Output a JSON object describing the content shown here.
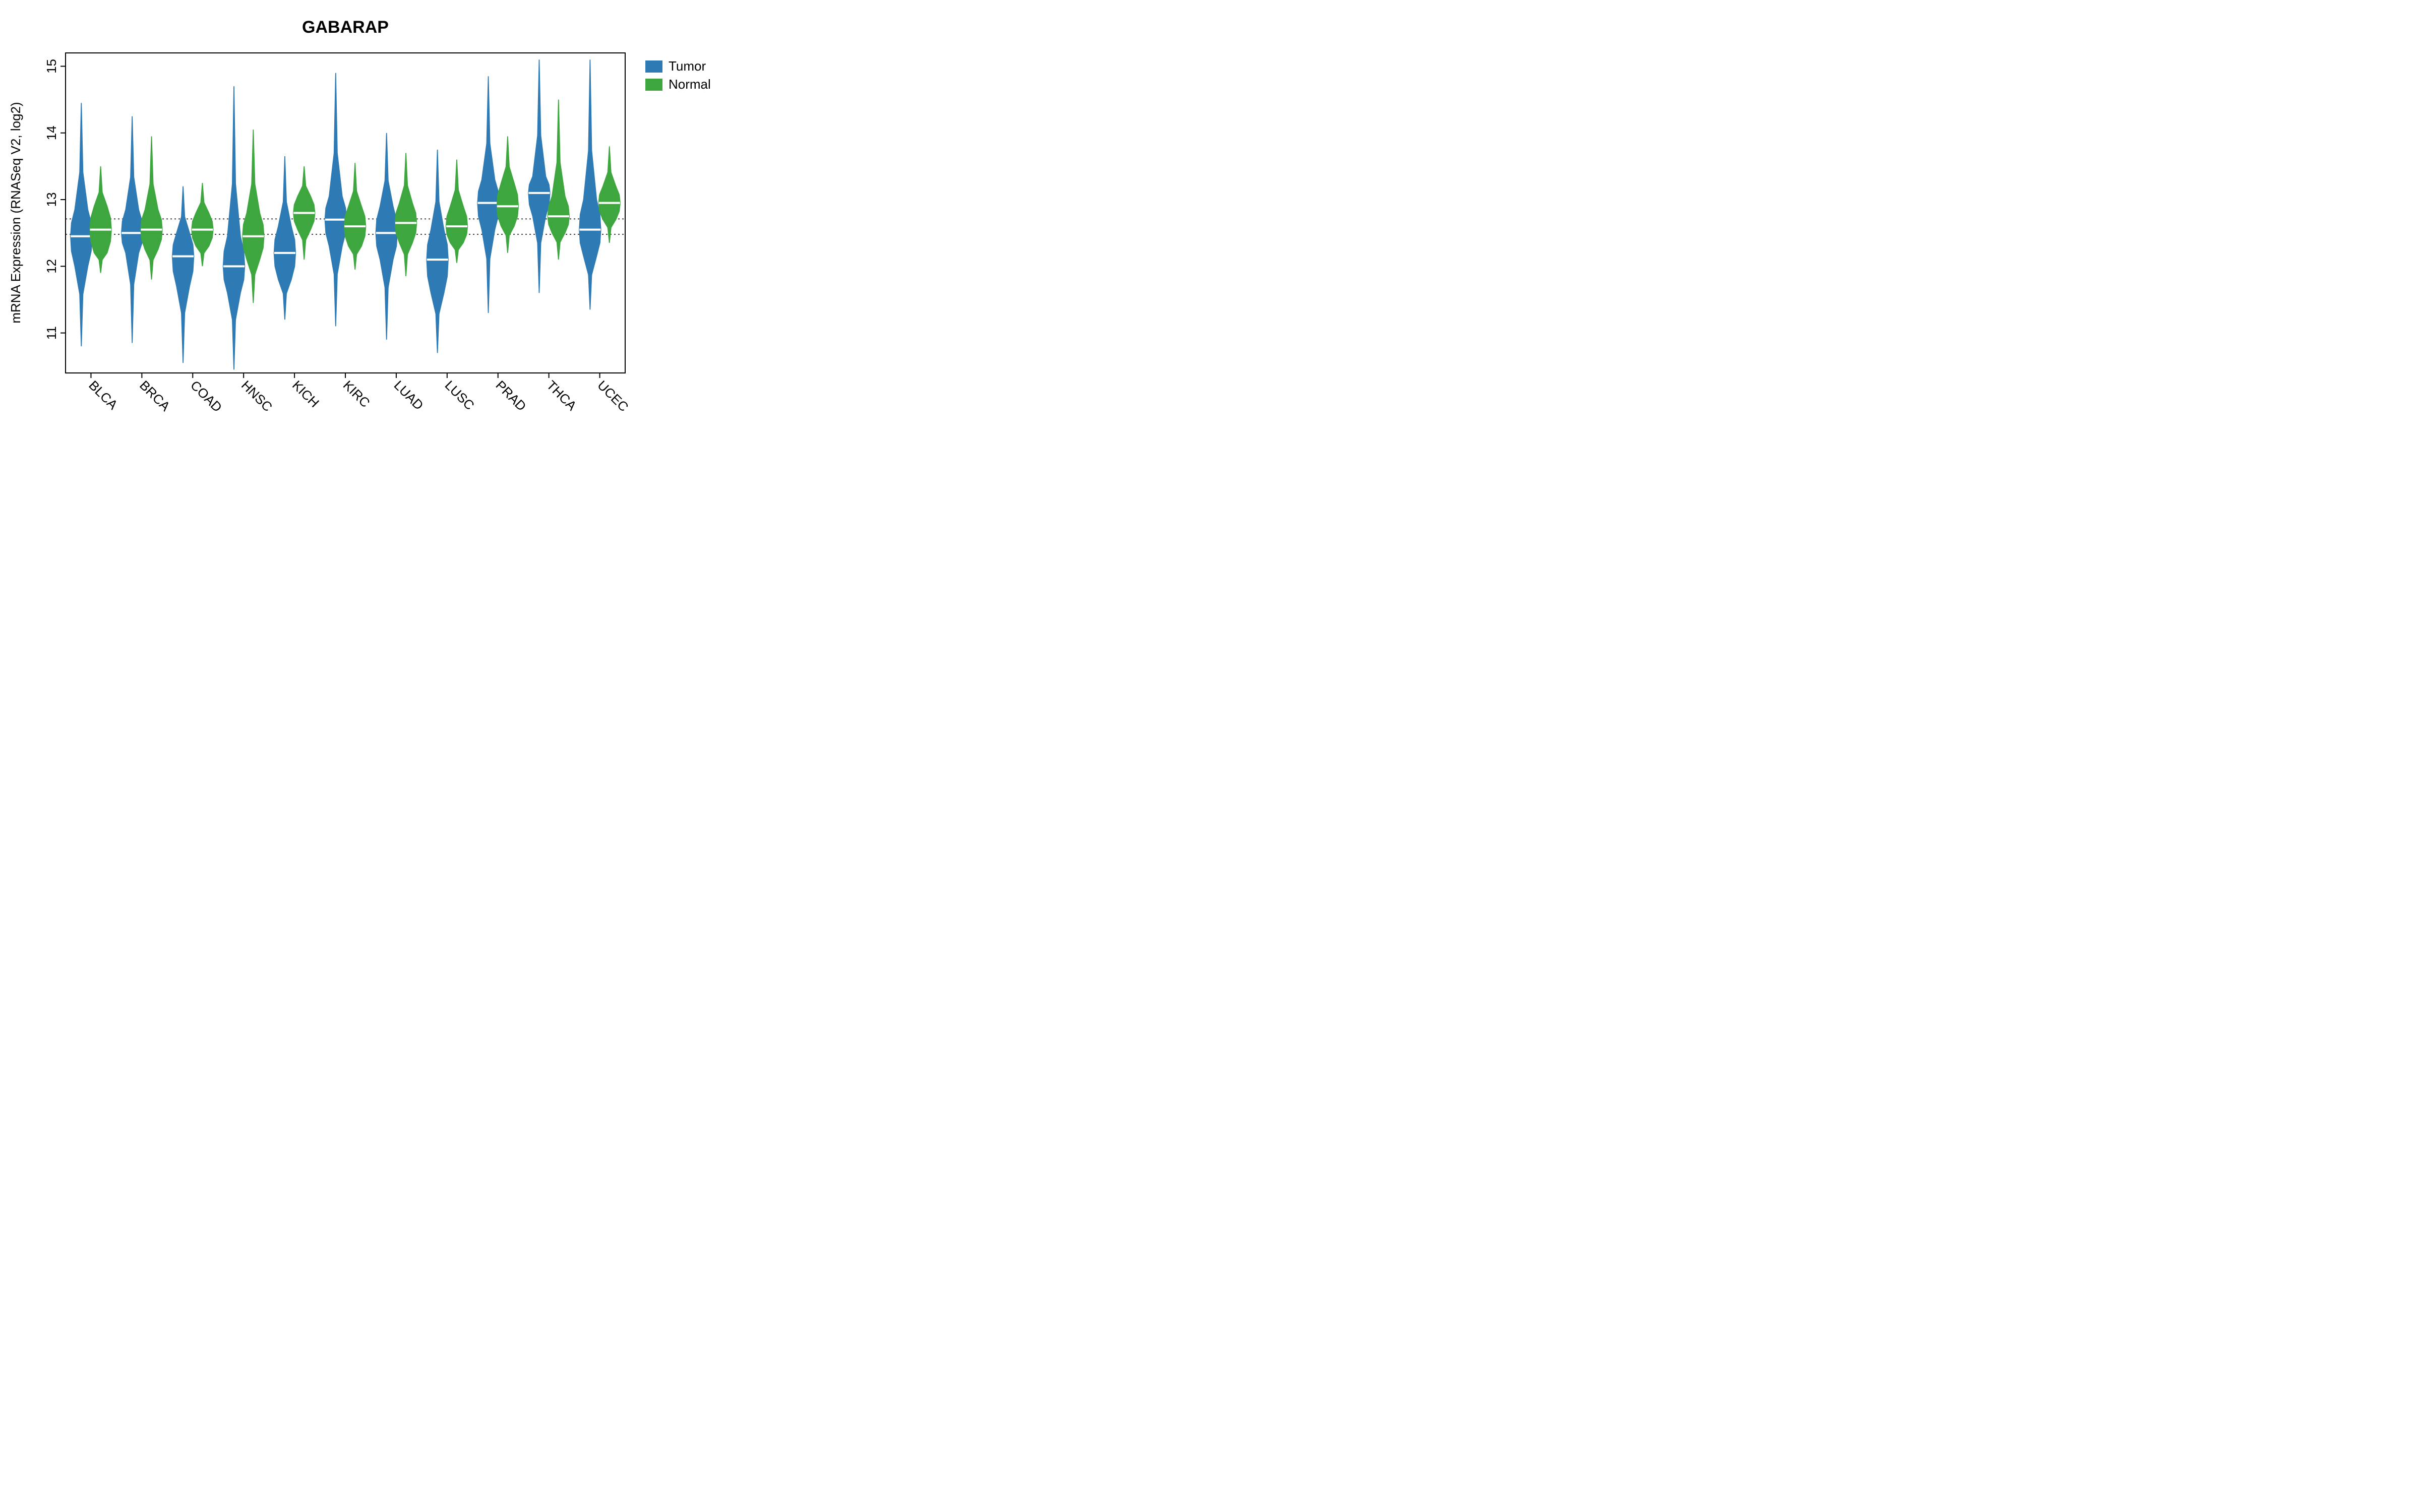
{
  "chart_data": {
    "type": "violin",
    "title": "GABARAP",
    "xlabel": "",
    "ylabel": "mRNA Expression (RNASeq V2, log2)",
    "ylim": [
      10.4,
      15.2
    ],
    "yticks": [
      11,
      12,
      13,
      14,
      15
    ],
    "reference_lines": [
      12.48,
      12.71
    ],
    "categories": [
      "BLCA",
      "BRCA",
      "COAD",
      "HNSC",
      "KICH",
      "KIRC",
      "LUAD",
      "LUSC",
      "PRAD",
      "THCA",
      "UCEC"
    ],
    "series": [
      {
        "name": "Tumor",
        "color": "#2e7ab4",
        "median": [
          12.45,
          12.5,
          12.15,
          12.0,
          12.2,
          12.7,
          12.5,
          12.1,
          12.95,
          13.1,
          12.55
        ],
        "q1": [
          12.0,
          12.2,
          11.7,
          11.6,
          11.8,
          12.3,
          12.1,
          11.6,
          12.55,
          12.75,
          12.15
        ],
        "q3": [
          12.85,
          12.85,
          12.5,
          12.45,
          12.6,
          13.05,
          12.9,
          12.55,
          13.3,
          13.35,
          13.0
        ],
        "min": [
          10.8,
          10.85,
          10.55,
          10.45,
          11.2,
          11.1,
          10.9,
          10.7,
          11.3,
          11.6,
          11.35
        ],
        "max": [
          14.45,
          14.25,
          13.2,
          14.7,
          13.65,
          14.9,
          14.0,
          13.75,
          14.85,
          15.1,
          15.1
        ]
      },
      {
        "name": "Normal",
        "color": "#3ea63e",
        "median": [
          12.55,
          12.55,
          12.55,
          12.45,
          12.8,
          12.6,
          12.65,
          12.6,
          12.9,
          12.75,
          12.95
        ],
        "q1": [
          12.2,
          12.25,
          12.3,
          12.1,
          12.55,
          12.3,
          12.35,
          12.35,
          12.6,
          12.5,
          12.7
        ],
        "q3": [
          12.9,
          12.85,
          12.8,
          12.8,
          13.05,
          12.9,
          12.95,
          12.9,
          13.25,
          13.05,
          13.2
        ],
        "min": [
          11.9,
          11.8,
          12.0,
          11.45,
          12.1,
          11.95,
          11.85,
          12.05,
          12.2,
          12.1,
          12.35
        ],
        "max": [
          13.5,
          13.95,
          13.25,
          14.05,
          13.5,
          13.55,
          13.7,
          13.6,
          13.95,
          14.5,
          13.8
        ]
      }
    ],
    "legend": {
      "entries": [
        "Tumor",
        "Normal"
      ],
      "position": "right"
    }
  },
  "colors": {
    "tumor": "#2e7ab4",
    "normal": "#3ea63e"
  }
}
